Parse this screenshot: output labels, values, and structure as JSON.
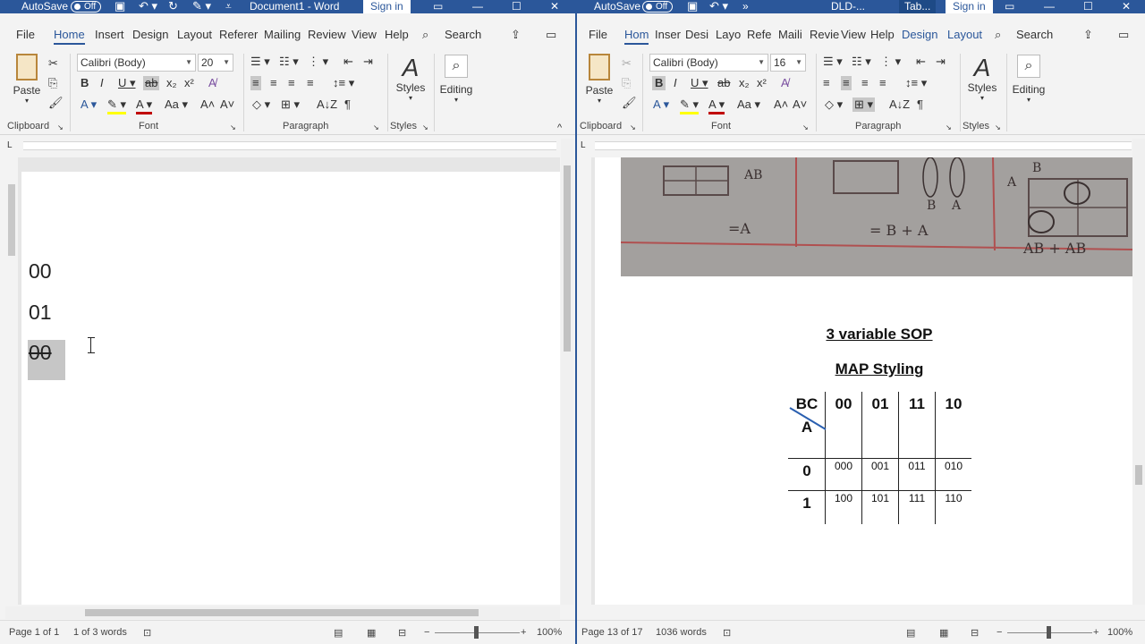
{
  "colors": {
    "accent": "#2b579a",
    "highlight": "#c6c6c6",
    "font_color_red": "#c00000",
    "highlight_yellow": "#ffff00"
  },
  "left": {
    "titlebar": {
      "autosave": "AutoSave",
      "autosave_state": "Off",
      "title": "Document1 - Word",
      "sign_in": "Sign in"
    },
    "tabs": [
      "File",
      "Home",
      "Insert",
      "Design",
      "Layout",
      "Referer",
      "Mailing",
      "Review",
      "View",
      "Help"
    ],
    "search": "Search",
    "ribbon": {
      "paste": "Paste",
      "font_name": "Calibri (Body)",
      "font_size": "20",
      "styles": "Styles",
      "editing": "Editing",
      "groups": [
        "Clipboard",
        "Font",
        "Paragraph",
        "Styles"
      ]
    },
    "document": {
      "lines": [
        "00",
        "01",
        "00"
      ]
    },
    "status": {
      "page": "Page 1 of 1",
      "words": "1 of 3 words",
      "zoom": "100%"
    }
  },
  "right": {
    "titlebar": {
      "autosave": "AutoSave",
      "autosave_state": "Off",
      "title": "DLD-...",
      "context_tab": "Tab...",
      "sign_in": "Sign in"
    },
    "tabs": [
      "File",
      "Hom",
      "Inser",
      "Desi",
      "Layo",
      "Refe",
      "Maili",
      "Revie",
      "View",
      "Help",
      "Design",
      "Layout"
    ],
    "search": "Search",
    "ribbon": {
      "paste": "Paste",
      "font_name": "Calibri (Body)",
      "font_size": "16",
      "styles": "Styles",
      "editing": "Editing",
      "groups": [
        "Clipboard",
        "Font",
        "Paragraph",
        "Styles"
      ]
    },
    "document": {
      "photo_notes": [
        "AB",
        "=A",
        "= B + A",
        "B",
        "A",
        "B",
        "A",
        "AB + AB"
      ],
      "title1": "3 variable SOP",
      "title2": "MAP Styling",
      "kmap": {
        "col_var": "BC",
        "row_var": "A",
        "cols": [
          "00",
          "01",
          "11",
          "10"
        ],
        "rows": [
          {
            "label": "0",
            "cells": [
              "000",
              "001",
              "011",
              "010"
            ]
          },
          {
            "label": "1",
            "cells": [
              "100",
              "101",
              "111",
              "110"
            ]
          }
        ]
      }
    },
    "status": {
      "page": "Page 13 of 17",
      "words": "1036 words",
      "zoom": "100%"
    }
  }
}
